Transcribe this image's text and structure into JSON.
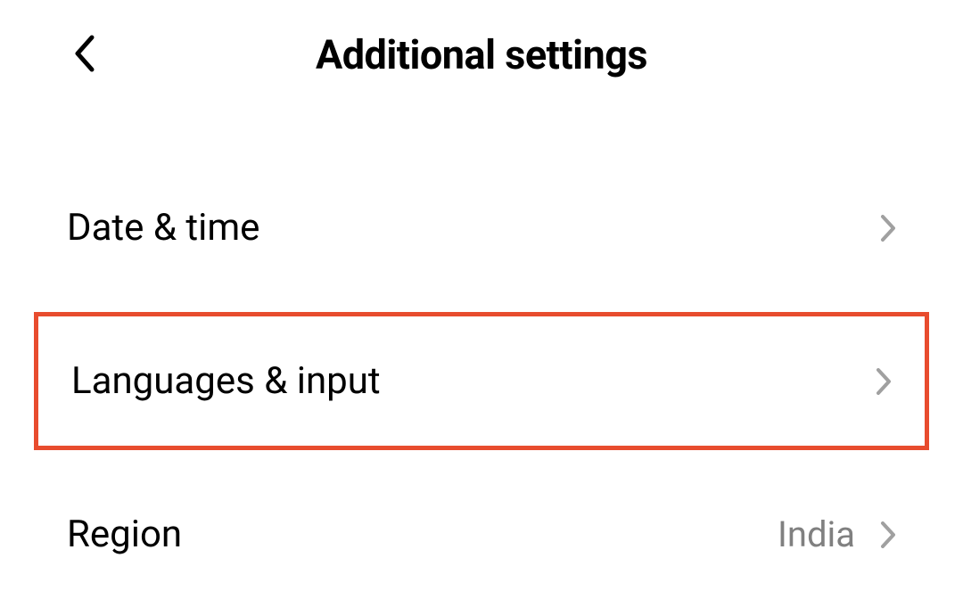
{
  "header": {
    "title": "Additional settings"
  },
  "items": [
    {
      "label": "Date & time",
      "value": "",
      "highlighted": false
    },
    {
      "label": "Languages & input",
      "value": "",
      "highlighted": true
    },
    {
      "label": "Region",
      "value": "India",
      "highlighted": false
    }
  ]
}
